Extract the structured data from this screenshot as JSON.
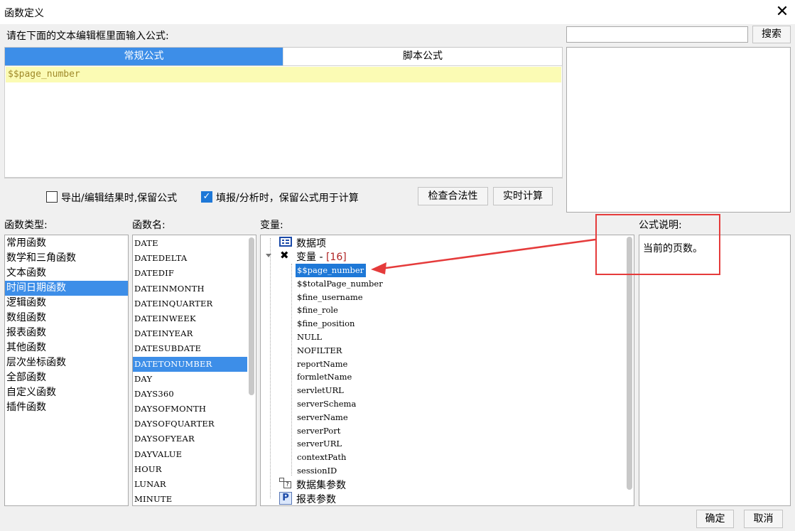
{
  "window": {
    "title": "函数定义",
    "close_symbol": "✕"
  },
  "instruction": "请在下面的文本编辑框里面输入公式:",
  "search": {
    "value": "",
    "button": "搜索"
  },
  "tabs": [
    {
      "label": "常规公式",
      "active": true
    },
    {
      "label": "脚本公式",
      "active": false
    }
  ],
  "editor": {
    "content": "$$page_number"
  },
  "options": {
    "keep_formula_label": "导出/编辑结果时,保留公式",
    "keep_formula_checked": false,
    "fill_label": "填报/分析时，保留公式用于计算",
    "fill_checked": true
  },
  "buttons": {
    "check": "检查合法性",
    "realtime": "实时计算",
    "ok": "确定",
    "cancel": "取消"
  },
  "sections": {
    "func_type": "函数类型:",
    "func_name": "函数名:",
    "variables": "变量:",
    "formula_desc": "公式说明:"
  },
  "func_types": [
    {
      "label": "常用函数",
      "selected": false
    },
    {
      "label": "数学和三角函数",
      "selected": false
    },
    {
      "label": "文本函数",
      "selected": false
    },
    {
      "label": "时间日期函数",
      "selected": true
    },
    {
      "label": "逻辑函数",
      "selected": false
    },
    {
      "label": "数组函数",
      "selected": false
    },
    {
      "label": "报表函数",
      "selected": false
    },
    {
      "label": "其他函数",
      "selected": false
    },
    {
      "label": "层次坐标函数",
      "selected": false
    },
    {
      "label": "全部函数",
      "selected": false
    },
    {
      "label": "自定义函数",
      "selected": false
    },
    {
      "label": "插件函数",
      "selected": false
    }
  ],
  "func_names": [
    {
      "label": "DATE",
      "selected": false
    },
    {
      "label": "DATEDELTA",
      "selected": false
    },
    {
      "label": "DATEDIF",
      "selected": false
    },
    {
      "label": "DATEINMONTH",
      "selected": false
    },
    {
      "label": "DATEINQUARTER",
      "selected": false
    },
    {
      "label": "DATEINWEEK",
      "selected": false
    },
    {
      "label": "DATEINYEAR",
      "selected": false
    },
    {
      "label": "DATESUBDATE",
      "selected": false
    },
    {
      "label": "DATETONUMBER",
      "selected": true
    },
    {
      "label": "DAY",
      "selected": false
    },
    {
      "label": "DAYS360",
      "selected": false
    },
    {
      "label": "DAYSOFMONTH",
      "selected": false
    },
    {
      "label": "DAYSOFQUARTER",
      "selected": false
    },
    {
      "label": "DAYSOFYEAR",
      "selected": false
    },
    {
      "label": "DAYVALUE",
      "selected": false
    },
    {
      "label": "HOUR",
      "selected": false
    },
    {
      "label": "LUNAR",
      "selected": false
    },
    {
      "label": "MINUTE",
      "selected": false
    }
  ],
  "variables_tree": {
    "dataset_item": "数据项",
    "var_group_label": "变量",
    "var_group_sep": " - ",
    "var_group_count": "[16]",
    "var_items": [
      {
        "label": "$$page_number",
        "selected": true
      },
      {
        "label": "$$totalPage_number",
        "selected": false
      },
      {
        "label": "$fine_username",
        "selected": false
      },
      {
        "label": "$fine_role",
        "selected": false
      },
      {
        "label": "$fine_position",
        "selected": false
      },
      {
        "label": "NULL",
        "selected": false
      },
      {
        "label": "NOFILTER",
        "selected": false
      },
      {
        "label": "reportName",
        "selected": false
      },
      {
        "label": "formletName",
        "selected": false
      },
      {
        "label": "servletURL",
        "selected": false
      },
      {
        "label": "serverSchema",
        "selected": false
      },
      {
        "label": "serverName",
        "selected": false
      },
      {
        "label": "serverPort",
        "selected": false
      },
      {
        "label": "serverURL",
        "selected": false
      },
      {
        "label": "contextPath",
        "selected": false
      },
      {
        "label": "sessionID",
        "selected": false
      }
    ],
    "dataset_params": "数据集参数",
    "report_params": "报表参数"
  },
  "description": "当前的页数。",
  "colors": {
    "selection": "#3d8ee8",
    "tab_active": "#3d8ee8",
    "highlight_line": "#fbfbb4",
    "annotation_red": "#e53b3b"
  }
}
